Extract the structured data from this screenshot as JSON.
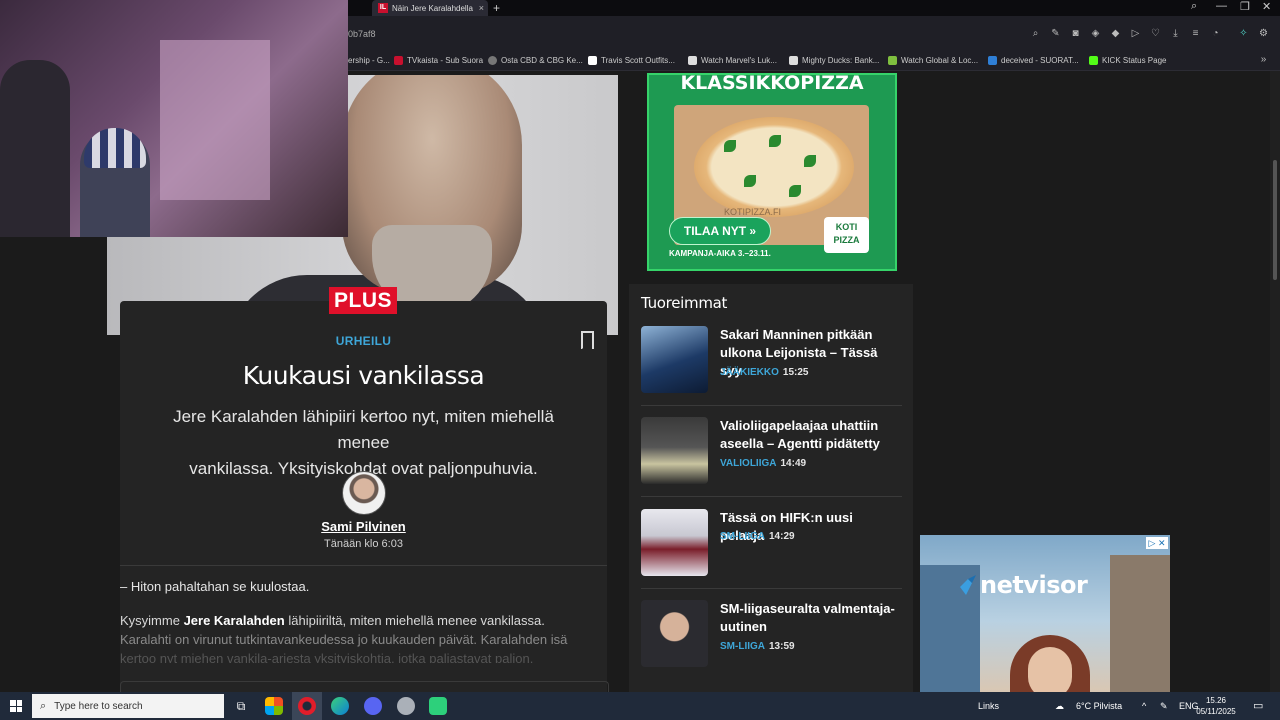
{
  "browser": {
    "tab_title": "Näin Jere Karalahdella me",
    "tab_favicon": "IL",
    "url_fragment": "0b7af8",
    "bookmarks": [
      {
        "label": "ership - G...",
        "icon": "bookmark-icon",
        "color": "#555555"
      },
      {
        "label": "TVkaista - Sub Suora",
        "icon": "tvkaista-icon",
        "color": "#c8102e"
      },
      {
        "label": "Osta CBD & CBG Ke...",
        "icon": "globe-icon",
        "color": "#777777"
      },
      {
        "label": "Travis Scott Outfits...",
        "icon": "bookmark-icon",
        "color": "#ffffff"
      },
      {
        "label": "Watch Marvel's Luk...",
        "icon": "bookmark-icon",
        "color": "#dddddd"
      },
      {
        "label": "Mighty Ducks: Bank...",
        "icon": "bookmark-icon",
        "color": "#dddddd"
      },
      {
        "label": "Watch Global & Loc...",
        "icon": "bookmark-icon",
        "color": "#7fbf3f"
      },
      {
        "label": "deceived - SUORAT...",
        "icon": "bookmark-icon",
        "color": "#2f7fd6"
      },
      {
        "label": "KICK Status Page",
        "icon": "kick-icon",
        "color": "#53fc18"
      }
    ]
  },
  "article": {
    "badge": "PLUS",
    "category": "URHEILU",
    "title": "Kuukausi vankilassa",
    "lead_line1": "Jere Karalahden lähipiiri kertoo nyt, miten miehellä menee",
    "lead_line2": "vankilassa. Yksityiskohdat ovat paljonpuhuvia.",
    "author": "Sami Pilvinen",
    "published": "Tänään klo 6:03",
    "quote": "– Hiton pahaltahan se kuulostaa.",
    "body_pre": "Kysyimme ",
    "body_name": "Jere Karalahden",
    "body_post": " lähipiiriltä, miten miehellä menee vankilassa.",
    "body_line2": "Karalahti on virunut tutkintavankeudessa jo kuukauden päivät. Karalahden isä",
    "body_line3": "kertoo nyt miehen vankila-arjesta yksityiskohtia, jotka paljastavat paljon."
  },
  "pizza_ad": {
    "title": "KLASSIKKOPIZZA",
    "cta": "TILAA NYT »",
    "brand_line1": "KOTI",
    "brand_line2": "PIZZA",
    "campaign": "KAMPANJA-AIKA 3.–23.11.",
    "watermark": "KOTIPIZZA.FI"
  },
  "latest": {
    "heading": "Tuoreimmat",
    "items": [
      {
        "title": "Sakari Manninen pitkään ulkona Leijonista – Tässä syy",
        "category": "JÄÄKIEKKO",
        "time": "15:25"
      },
      {
        "title": "Valioliigapelaajaa uhattiin aseella – Agentti pidätetty",
        "category": "VALIOLIIGA",
        "time": "14:49"
      },
      {
        "title": "Tässä on HIFK:n uusi pelaaja",
        "category": "SM-LIIGA",
        "time": "14:29"
      },
      {
        "title": "SM-liigaseuralta valmentaja-uutinen",
        "category": "SM-LIIGA",
        "time": "13:59"
      }
    ]
  },
  "netvisor_ad": {
    "logo": "netvisor"
  },
  "taskbar": {
    "search_placeholder": "Type here to search",
    "links": "Links",
    "weather": "6°C Pilvista",
    "lang": "ENG",
    "time": "15.26",
    "date": "05/11/2025"
  },
  "colors": {
    "accent": "#3ea6d8",
    "plus_badge": "#e0102a",
    "page_bg": "#1b1b1b",
    "card_bg": "#242424"
  }
}
